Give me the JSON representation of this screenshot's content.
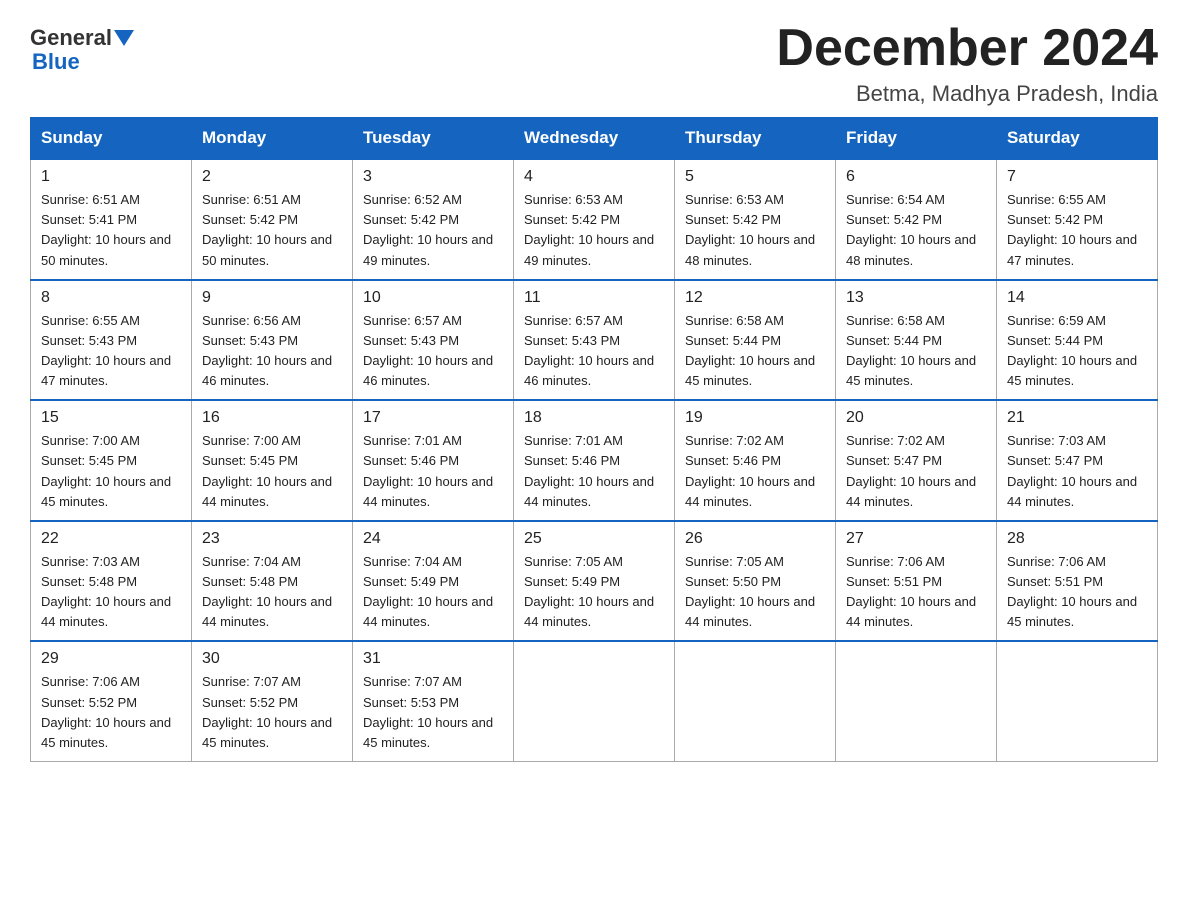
{
  "header": {
    "logo_general": "General",
    "logo_blue": "Blue",
    "month_title": "December 2024",
    "subtitle": "Betma, Madhya Pradesh, India"
  },
  "weekdays": [
    "Sunday",
    "Monday",
    "Tuesday",
    "Wednesday",
    "Thursday",
    "Friday",
    "Saturday"
  ],
  "weeks": [
    [
      {
        "day": "1",
        "sunrise": "Sunrise: 6:51 AM",
        "sunset": "Sunset: 5:41 PM",
        "daylight": "Daylight: 10 hours and 50 minutes."
      },
      {
        "day": "2",
        "sunrise": "Sunrise: 6:51 AM",
        "sunset": "Sunset: 5:42 PM",
        "daylight": "Daylight: 10 hours and 50 minutes."
      },
      {
        "day": "3",
        "sunrise": "Sunrise: 6:52 AM",
        "sunset": "Sunset: 5:42 PM",
        "daylight": "Daylight: 10 hours and 49 minutes."
      },
      {
        "day": "4",
        "sunrise": "Sunrise: 6:53 AM",
        "sunset": "Sunset: 5:42 PM",
        "daylight": "Daylight: 10 hours and 49 minutes."
      },
      {
        "day": "5",
        "sunrise": "Sunrise: 6:53 AM",
        "sunset": "Sunset: 5:42 PM",
        "daylight": "Daylight: 10 hours and 48 minutes."
      },
      {
        "day": "6",
        "sunrise": "Sunrise: 6:54 AM",
        "sunset": "Sunset: 5:42 PM",
        "daylight": "Daylight: 10 hours and 48 minutes."
      },
      {
        "day": "7",
        "sunrise": "Sunrise: 6:55 AM",
        "sunset": "Sunset: 5:42 PM",
        "daylight": "Daylight: 10 hours and 47 minutes."
      }
    ],
    [
      {
        "day": "8",
        "sunrise": "Sunrise: 6:55 AM",
        "sunset": "Sunset: 5:43 PM",
        "daylight": "Daylight: 10 hours and 47 minutes."
      },
      {
        "day": "9",
        "sunrise": "Sunrise: 6:56 AM",
        "sunset": "Sunset: 5:43 PM",
        "daylight": "Daylight: 10 hours and 46 minutes."
      },
      {
        "day": "10",
        "sunrise": "Sunrise: 6:57 AM",
        "sunset": "Sunset: 5:43 PM",
        "daylight": "Daylight: 10 hours and 46 minutes."
      },
      {
        "day": "11",
        "sunrise": "Sunrise: 6:57 AM",
        "sunset": "Sunset: 5:43 PM",
        "daylight": "Daylight: 10 hours and 46 minutes."
      },
      {
        "day": "12",
        "sunrise": "Sunrise: 6:58 AM",
        "sunset": "Sunset: 5:44 PM",
        "daylight": "Daylight: 10 hours and 45 minutes."
      },
      {
        "day": "13",
        "sunrise": "Sunrise: 6:58 AM",
        "sunset": "Sunset: 5:44 PM",
        "daylight": "Daylight: 10 hours and 45 minutes."
      },
      {
        "day": "14",
        "sunrise": "Sunrise: 6:59 AM",
        "sunset": "Sunset: 5:44 PM",
        "daylight": "Daylight: 10 hours and 45 minutes."
      }
    ],
    [
      {
        "day": "15",
        "sunrise": "Sunrise: 7:00 AM",
        "sunset": "Sunset: 5:45 PM",
        "daylight": "Daylight: 10 hours and 45 minutes."
      },
      {
        "day": "16",
        "sunrise": "Sunrise: 7:00 AM",
        "sunset": "Sunset: 5:45 PM",
        "daylight": "Daylight: 10 hours and 44 minutes."
      },
      {
        "day": "17",
        "sunrise": "Sunrise: 7:01 AM",
        "sunset": "Sunset: 5:46 PM",
        "daylight": "Daylight: 10 hours and 44 minutes."
      },
      {
        "day": "18",
        "sunrise": "Sunrise: 7:01 AM",
        "sunset": "Sunset: 5:46 PM",
        "daylight": "Daylight: 10 hours and 44 minutes."
      },
      {
        "day": "19",
        "sunrise": "Sunrise: 7:02 AM",
        "sunset": "Sunset: 5:46 PM",
        "daylight": "Daylight: 10 hours and 44 minutes."
      },
      {
        "day": "20",
        "sunrise": "Sunrise: 7:02 AM",
        "sunset": "Sunset: 5:47 PM",
        "daylight": "Daylight: 10 hours and 44 minutes."
      },
      {
        "day": "21",
        "sunrise": "Sunrise: 7:03 AM",
        "sunset": "Sunset: 5:47 PM",
        "daylight": "Daylight: 10 hours and 44 minutes."
      }
    ],
    [
      {
        "day": "22",
        "sunrise": "Sunrise: 7:03 AM",
        "sunset": "Sunset: 5:48 PM",
        "daylight": "Daylight: 10 hours and 44 minutes."
      },
      {
        "day": "23",
        "sunrise": "Sunrise: 7:04 AM",
        "sunset": "Sunset: 5:48 PM",
        "daylight": "Daylight: 10 hours and 44 minutes."
      },
      {
        "day": "24",
        "sunrise": "Sunrise: 7:04 AM",
        "sunset": "Sunset: 5:49 PM",
        "daylight": "Daylight: 10 hours and 44 minutes."
      },
      {
        "day": "25",
        "sunrise": "Sunrise: 7:05 AM",
        "sunset": "Sunset: 5:49 PM",
        "daylight": "Daylight: 10 hours and 44 minutes."
      },
      {
        "day": "26",
        "sunrise": "Sunrise: 7:05 AM",
        "sunset": "Sunset: 5:50 PM",
        "daylight": "Daylight: 10 hours and 44 minutes."
      },
      {
        "day": "27",
        "sunrise": "Sunrise: 7:06 AM",
        "sunset": "Sunset: 5:51 PM",
        "daylight": "Daylight: 10 hours and 44 minutes."
      },
      {
        "day": "28",
        "sunrise": "Sunrise: 7:06 AM",
        "sunset": "Sunset: 5:51 PM",
        "daylight": "Daylight: 10 hours and 45 minutes."
      }
    ],
    [
      {
        "day": "29",
        "sunrise": "Sunrise: 7:06 AM",
        "sunset": "Sunset: 5:52 PM",
        "daylight": "Daylight: 10 hours and 45 minutes."
      },
      {
        "day": "30",
        "sunrise": "Sunrise: 7:07 AM",
        "sunset": "Sunset: 5:52 PM",
        "daylight": "Daylight: 10 hours and 45 minutes."
      },
      {
        "day": "31",
        "sunrise": "Sunrise: 7:07 AM",
        "sunset": "Sunset: 5:53 PM",
        "daylight": "Daylight: 10 hours and 45 minutes."
      },
      null,
      null,
      null,
      null
    ]
  ]
}
